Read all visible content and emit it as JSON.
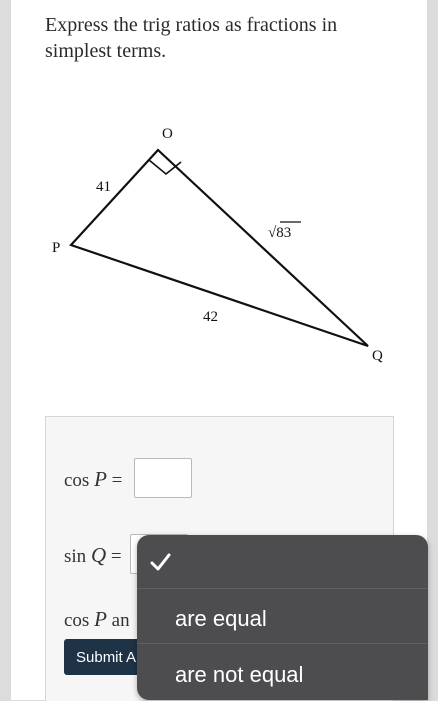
{
  "question": {
    "prompt": "Express the trig ratios as fractions in simplest terms."
  },
  "figure": {
    "vertices": {
      "o": "O",
      "p": "P",
      "q": "Q"
    },
    "sides": {
      "op": "41",
      "oq": "√83",
      "pq": "42"
    },
    "right_angle_at": "O"
  },
  "equations": {
    "cos_p": {
      "fn": "cos",
      "var": "P",
      "eq": "="
    },
    "sin_q": {
      "fn": "sin",
      "var": "Q",
      "eq": "="
    },
    "compare": {
      "fn": "cos",
      "var": "P",
      "rest": "an"
    }
  },
  "submit_label": "Submit A",
  "dropdown": {
    "items": [
      {
        "label": "",
        "selected": true
      },
      {
        "label": "are equal",
        "selected": false
      },
      {
        "label": "are not equal",
        "selected": false
      }
    ]
  },
  "colors": {
    "submit_bg": "#1f3347",
    "menu_bg": "#4d4d4f"
  }
}
